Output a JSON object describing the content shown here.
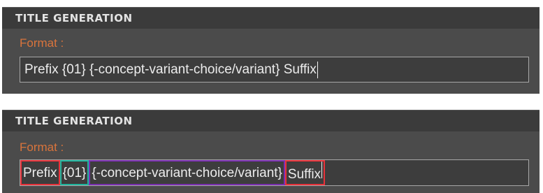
{
  "panels": [
    {
      "title": "TITLE GENERATION",
      "label": "Format :",
      "value": "Prefix {01} {-concept-variant-choice/variant} Suffix"
    },
    {
      "title": "TITLE GENERATION",
      "label": "Format :",
      "segments": [
        {
          "text": "Prefix",
          "kind": "prefix",
          "color": "#e8323a"
        },
        {
          "text": "{01}",
          "kind": "counter",
          "color": "#1fb59e"
        },
        {
          "text": "{-concept-variant-choice/variant}",
          "kind": "variant-token",
          "color": "#7a2fb1"
        },
        {
          "text": "Suffix",
          "kind": "suffix",
          "color": "#e8323a"
        }
      ]
    }
  ],
  "colors": {
    "panel_bg": "#4b4b4b",
    "header_bg": "#3b3b3b",
    "label": "#d9743c",
    "input_bg": "#3d3d3d"
  }
}
